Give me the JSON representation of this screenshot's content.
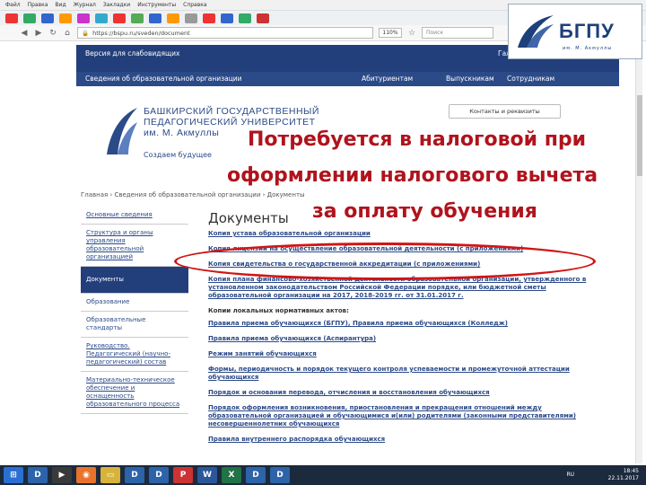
{
  "browser": {
    "menu": [
      "Файл",
      "Правка",
      "Вид",
      "Журнал",
      "Закладки",
      "Инструменты",
      "Справка"
    ],
    "url": "https://bspu.ru/sveden/document",
    "zoom": "110%",
    "search_placeholder": "Поиск"
  },
  "logo": {
    "text": "БГПУ",
    "sub": "им. М. Акмуллы"
  },
  "site": {
    "visually_impaired": "Версия для слабовидящих",
    "user": "Галия",
    "section_title": "Сведения об образовательной организации",
    "nav": [
      "Абитуриентам",
      "Выпускникам",
      "Сотрудникам"
    ],
    "uni_name": [
      "БАШКИРСКИЙ ГОСУДАРСТВЕННЫЙ",
      "ПЕДАГОГИЧЕСКИЙ УНИВЕРСИТЕТ",
      "им. М. Акмуллы"
    ],
    "slogan": "Создаем будущее",
    "contacts": "Контакты и реквизиты"
  },
  "overlay": {
    "line1": "Потребуется в налоговой при",
    "line2": "оформлении налогового вычета",
    "line3": "за оплату обучения"
  },
  "breadcrumb": "Главная › Сведения об образовательной организации › Документы",
  "sidebar": [
    "Основные сведения",
    "Структура и органы управления образовательной организацией",
    "Документы",
    "Образование",
    "Образовательные стандарты",
    "Руководство. Педагогический (научно-педагогический) состав",
    "Материально-техническое обеспечение и оснащенность образовательного процесса"
  ],
  "doc": {
    "title": "Документы",
    "links": [
      "Копия устава образовательной организации",
      "Копия лицензии на осуществление образовательной деятельности (с приложениями)",
      "Копия свидетельства о государственной аккредитации (с приложениями)",
      "Копия плана финансово-хозяйственной деятельности образовательной организации, утвержденного в установленном законодательством Российской Федерации порядке, или бюджетной сметы образовательной организации на 2017, 2018-2019 гг. от 31.01.2017 г."
    ],
    "local_acts_title": "Копии локальных нормативных актов:",
    "local_acts": [
      "Правила приема обучающихся (БГПУ), Правила приема обучающихся (Колледж)",
      "Правила приема обучающихся (Аспирантура)",
      "Режим занятий обучающихся",
      "Формы, периодичность и порядок текущего контроля успеваемости и промежуточной аттестации обучающихся",
      "Порядок и основания перевода, отчисления и восстановления обучающихся",
      "Порядок оформления возникновения, приостановления и прекращения отношений между образовательной организацией и обучающимися и(или) родителями (законными представителями) несовершеннолетних обучающихся",
      "Правила внутреннего распорядка обучающихся"
    ]
  },
  "taskbar": {
    "lang": "RU",
    "time": "18:45",
    "date": "22.11.2017"
  },
  "colors": {
    "brand": "#233f7b",
    "overlay_text": "#b0131d",
    "ellipse": "#d01515"
  }
}
